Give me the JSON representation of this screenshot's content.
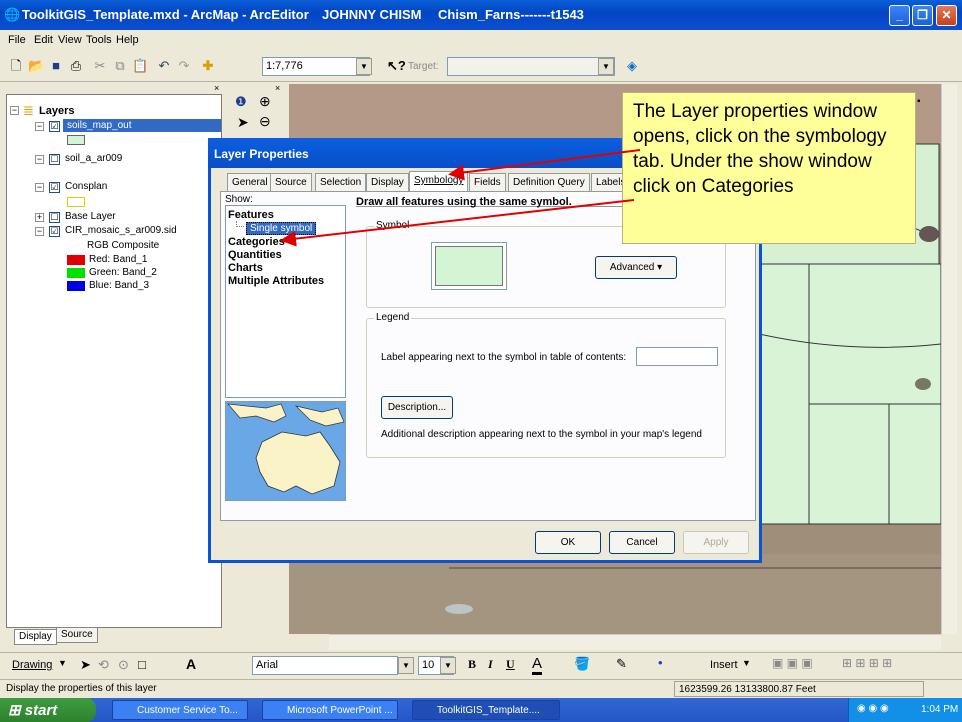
{
  "window": {
    "title": "ToolkitGIS_Template.mxd - ArcMap - ArcEditor",
    "user": "JOHNNY CHISM",
    "project": "Chism_Farns-------t1543"
  },
  "menu": [
    "File",
    "Edit",
    "View",
    "Tools",
    "Help"
  ],
  "toolbar": {
    "scale": "1:7,776",
    "target_label": "Target:"
  },
  "toc": {
    "root": "Layers",
    "layers": [
      {
        "name": "soils_map_out",
        "checked": "☑"
      },
      {
        "name": "soil_a_ar009",
        "checked": "☐"
      },
      {
        "name": "Consplan",
        "checked": "☑"
      },
      {
        "name": "Base Layer",
        "checked": "☐"
      },
      {
        "name": "CIR_mosaic_s_ar009.sid",
        "checked": "☑"
      }
    ],
    "rgb": {
      "label": "RGB Composite",
      "red": "Red:   Band_1",
      "green": "Green: Band_2",
      "blue": "Blue:  Band_3"
    },
    "tabs": [
      "Display",
      "Source"
    ]
  },
  "dialog": {
    "title": "Layer Properties",
    "tabs": [
      "General",
      "Source",
      "Selection",
      "Display",
      "Symbology",
      "Fields",
      "Definition Query",
      "Labels"
    ],
    "show_label": "Show:",
    "show_items": [
      "Features",
      "Single symbol",
      "Categories",
      "Quantities",
      "Charts",
      "Multiple Attributes"
    ],
    "heading": "Draw all features using the same symbol.",
    "symbol_group": "Symbol",
    "advanced": "Advanced",
    "legend_group": "Legend",
    "legend_label": "Label appearing next to the symbol in table of contents:",
    "description_btn": "Description...",
    "description_text": "Additional description appearing next to the symbol in your map's legend",
    "ok": "OK",
    "cancel": "Cancel",
    "apply": "Apply"
  },
  "callout": {
    "text": "The Layer properties window opens, click on the symbology tab. Under the show window click on Categories"
  },
  "drawbar": {
    "drawing": "Drawing",
    "font": "Arial",
    "size": "10",
    "insert": "Insert"
  },
  "status": {
    "message": "Display the properties of this layer",
    "coords": "1623599.26  13133800.87 Feet"
  },
  "taskbar": {
    "start": "start",
    "items": [
      "Customer Service To...",
      "Microsoft PowerPoint ...",
      "ToolkitGIS_Template...."
    ],
    "clock": "1:04 PM"
  },
  "colors": {
    "selection": "#316ac5",
    "symbol_fill": "#d3f5d3",
    "callout": "#ffff99",
    "title_blue": "#0a4fd0"
  }
}
